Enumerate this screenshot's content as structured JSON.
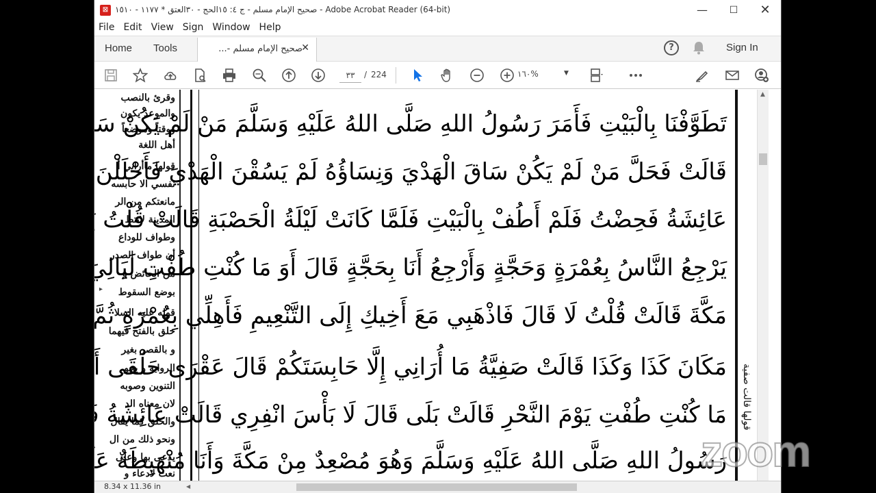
{
  "window": {
    "title": "صحيح الإمام مسلم - ج ٤: ١٥الحج - ٣٠العتق * ١١٧٧ - ١٥١٠ - Adobe Acrobat Reader (64-bit)",
    "app_icon": "acrobat-pdf-icon"
  },
  "menu": [
    "File",
    "Edit",
    "View",
    "Sign",
    "Window",
    "Help"
  ],
  "tabs": {
    "home": "Home",
    "tools": "Tools",
    "document": "صحيح الإمام مسلم -...",
    "sign_in": "Sign In"
  },
  "toolbar": {
    "page_current": "٣٣",
    "page_separator": "/",
    "page_total": "224",
    "zoom": "١٦٠%"
  },
  "margin_text": [
    "وقرئ بالنصب",
    "والموعد يكون",
    "ووقتاً وموضعاً",
    "أهل اللغة",
    "قولها ماأراني أ",
    "نفسي الا حابسه",
    "مانعتكم من الر",
    "المدينة لانتظ",
    "وطواف للوداع",
    "أن طواف الصدر",
    "من الحائض و",
    "بوضع السقوط",
    "قوله عليه السلا",
    "حلق بالفتح فيهما",
    "و بالقصر بغير",
    "الرواية و يجو",
    "التنوين وصوبه",
    "لان معناه الد",
    "والحلق كما يقال",
    "ونحو ذلك من ال",
    "يدعى بها وعلى",
    "نعت لادعاء و"
  ],
  "main_lines": [
    "تَطَوَّفْنَا بِالْبَيْتِ فَأَمَرَ رَسُولُ اللهِ صَلَّى اللهُ عَلَيْهِ وَسَلَّمَ مَنْ لَمْ يَكُنْ سَاقَ الْهَدْيَ أَنْ يَحِلَّ",
    "قَالَتْ فَحَلَّ مَنْ لَمْ يَكُنْ سَاقَ الْهَدْيَ وَنِسَاؤُهُ لَمْ يَسُقْنَ الْهَدْيَ فَأَحْلَلْنَ قَالَتْ",
    "عَائِشَةُ فَحِضْتُ فَلَمْ أَطُفْ بِالْبَيْتِ فَلَمَّا كَانَتْ لَيْلَةُ الْحَصْبَةِ قَالَتْ قُلْتُ يَا رَسُولَ اللهِ",
    "يَرْجِعُ النَّاسُ بِعُمْرَةٍ وَحَجَّةٍ وَأَرْجِعُ أَنَا بِحَجَّةٍ قَالَ أَوَ مَا كُنْتِ طُفْتِ لَيَالِيَ قَدِمْنَا",
    "مَكَّةَ قَالَتْ قُلْتُ لَا قَالَ فَاذْهَبِي مَعَ أَخِيكِ إِلَى التَّنْعِيمِ فَأَهِلِّي بِعُمْرَةٍ ثُمَّ مَوْعِدُكِ",
    "مَكَانَ كَذَا وَكَذَا قَالَتْ صَفِيَّةُ مَا أُرَانِي إِلَّا حَابِسَتَكُمْ قَالَ عَقْرَى حَلْقَى أَوَ",
    "مَا كُنْتِ طُفْتِ يَوْمَ النَّحْرِ قَالَتْ بَلَى قَالَ لَا بَأْسَ انْفِرِي قَالَتْ عَائِشَةُ فَلَقِيَنِي",
    "رَسُولُ اللهِ صَلَّى اللهُ عَلَيْهِ وَسَلَّمَ وَهُوَ مُصْعِدٌ مِنْ مَكَّةَ وَأَنَا مُنْهَبِطَةٌ عَلَيْهَا أَوْ أَنَا"
  ],
  "side_note": "قولها قالت صفية",
  "status": {
    "page_size": "8.34 x 11.36 in"
  },
  "watermark": "zoom",
  "colors": {
    "acrobat_red": "#d6201b",
    "select_blue": "#1473e6"
  }
}
